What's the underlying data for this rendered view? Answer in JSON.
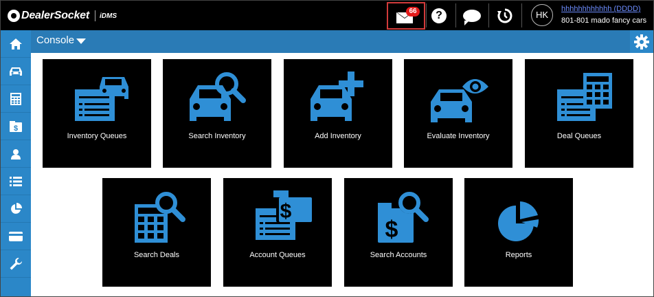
{
  "header": {
    "logo_text": "DealerSocket",
    "logo_sub": "iDMS",
    "mail_badge": "66",
    "help_glyph": "?",
    "avatar_initials": "HK",
    "user_name": "hhhhhhhhhhhh (DDDD)",
    "user_sub": "801-801 mado fancy cars",
    "icons": [
      "mail-icon",
      "help-icon",
      "chat-icon",
      "history-icon"
    ]
  },
  "sidebar": {
    "items": [
      {
        "icon": "home-icon"
      },
      {
        "icon": "car-icon"
      },
      {
        "icon": "calculator-icon"
      },
      {
        "icon": "money-bag-icon"
      },
      {
        "icon": "person-icon"
      },
      {
        "icon": "list-icon"
      },
      {
        "icon": "pie-chart-icon"
      },
      {
        "icon": "credit-card-icon"
      },
      {
        "icon": "wrench-icon"
      }
    ]
  },
  "console": {
    "title": "Console",
    "settings_icon": "gear-icon"
  },
  "tiles": [
    {
      "label": "Inventory Queues",
      "icon": "inventory-queue-icon"
    },
    {
      "label": "Search Inventory",
      "icon": "search-car-icon"
    },
    {
      "label": "Add Inventory",
      "icon": "add-car-icon"
    },
    {
      "label": "Evaluate Inventory",
      "icon": "evaluate-car-icon"
    },
    {
      "label": "Deal Queues",
      "icon": "deal-queue-icon"
    },
    {
      "label": "Search Deals",
      "icon": "search-deals-icon"
    },
    {
      "label": "Account Queues",
      "icon": "account-queue-icon"
    },
    {
      "label": "Search Accounts",
      "icon": "search-accounts-icon"
    },
    {
      "label": "Reports",
      "icon": "reports-icon"
    }
  ],
  "colors": {
    "accent": "#2b87c8",
    "console_bar": "#2a7bb6",
    "tile_bg": "#000000",
    "badge": "#e21b1b",
    "highlight_border": "#d23b3b"
  }
}
